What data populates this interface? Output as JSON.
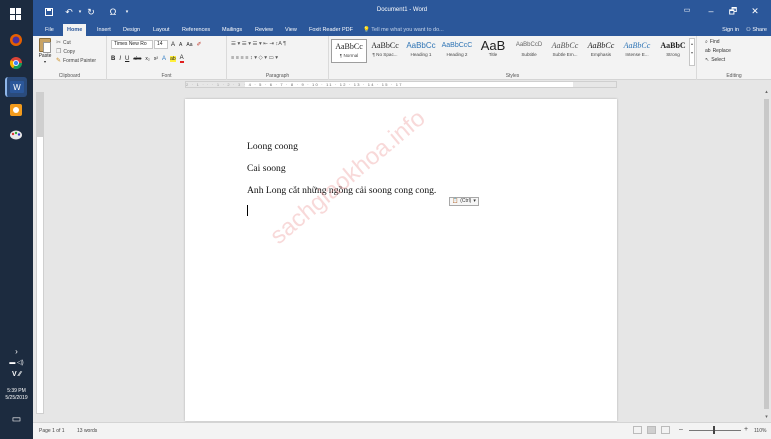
{
  "taskbar": {
    "time": "5:39 PM",
    "date": "5/25/2019"
  },
  "window": {
    "title": "Document1 - Word",
    "controls": {
      "restore": "▭",
      "minimize": "–",
      "maximize": "🗗",
      "close": "✕"
    }
  },
  "tabs": [
    {
      "label": "File"
    },
    {
      "label": "Home"
    },
    {
      "label": "Insert"
    },
    {
      "label": "Design"
    },
    {
      "label": "Layout"
    },
    {
      "label": "References"
    },
    {
      "label": "Mailings"
    },
    {
      "label": "Review"
    },
    {
      "label": "View"
    },
    {
      "label": "Foxit Reader PDF"
    }
  ],
  "tell_me": "Tell me what you want to do...",
  "account": {
    "signin": "Sign in",
    "share": "Share"
  },
  "ribbon": {
    "clipboard": {
      "paste": "Paste",
      "cut": "Cut",
      "copy": "Copy",
      "format_painter": "Format Painter",
      "label": "Clipboard"
    },
    "font": {
      "name": "Times New Ro",
      "size": "14",
      "grow": "A",
      "shrink": "A",
      "case": "Aa",
      "clear": "✐",
      "bold": "B",
      "italic": "I",
      "underline": "U",
      "strike": "abc",
      "sub": "x₂",
      "sup": "x²",
      "effects": "A",
      "highlight": "ab",
      "color": "A",
      "label": "Font"
    },
    "paragraph": {
      "row1": "☰ ▾ ☰ ▾ ☰ ▾  ⇤ ⇥  ↕A  ¶",
      "row2": "≡ ≡ ≡ ≡  ↕ ▾  ◇ ▾  ▭ ▾",
      "label": "Paragraph"
    },
    "styles": {
      "items": [
        {
          "sample": "AaBbCc",
          "name": "¶ Normal"
        },
        {
          "sample": "AaBbCc",
          "name": "¶ No Spac..."
        },
        {
          "sample": "AaBbCc",
          "name": "Heading 1"
        },
        {
          "sample": "AaBbCcC",
          "name": "Heading 2"
        },
        {
          "sample": "AaB",
          "name": "Title"
        },
        {
          "sample": "AaBbCcD",
          "name": "Subtitle"
        },
        {
          "sample": "AaBbCc",
          "name": "Subtle Em..."
        },
        {
          "sample": "AaBbCc",
          "name": "Emphasis"
        },
        {
          "sample": "AaBbCc",
          "name": "Intense E..."
        },
        {
          "sample": "AaBbC",
          "name": "Strong"
        }
      ],
      "label": "Styles"
    },
    "editing": {
      "find": "Find",
      "replace": "Replace",
      "select": "Select",
      "label": "Editing"
    }
  },
  "ruler": {
    "corner": "L",
    "ticks": "2 · 1 · · · 1 · 2 · 3 · 4 · 5 · 6 · 7 · 8 · 9 · 10 · 11 · 12 · 13 · 14 · 15 · 17"
  },
  "document": {
    "paragraphs": [
      "Loong coong",
      "Cai soong",
      "Anh Long cắt những ngồng cải soong cong cong."
    ],
    "paste_options": "(Ctrl)",
    "watermark": "sachgiaokhoa.info"
  },
  "status": {
    "page": "Page 1 of 1",
    "words": "13 words",
    "zoom_minus": "–",
    "zoom_plus": "+",
    "zoom": "110%"
  },
  "colors": {
    "accent": "#2b579a",
    "taskbar": "#1c2b3f"
  }
}
